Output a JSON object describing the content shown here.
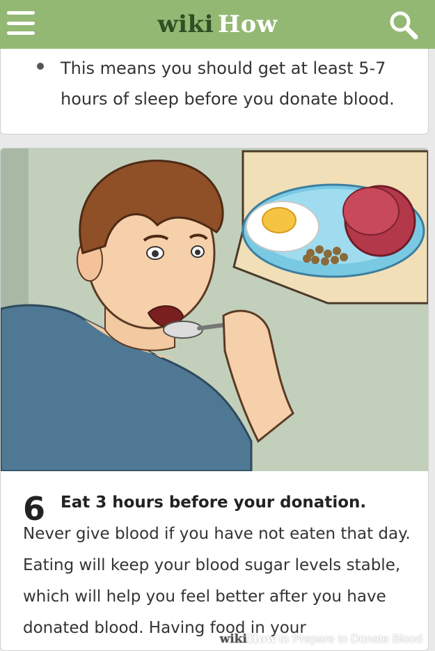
{
  "header": {
    "logo_wiki": "wiki",
    "logo_how": "How",
    "menu_icon": "hamburger-menu-icon",
    "search_icon": "search-icon",
    "bar_color": "#93b874"
  },
  "previous_card": {
    "bullet_text": "This means you should get at least 5-7 hours of sleep before you donate blood."
  },
  "step": {
    "number": "6",
    "title": "Eat 3 hours before your donation.",
    "body": " Never give blood if you have not eaten that day. Eating will keep your blood sugar levels stable, which will help you feel better after you have donated blood. Having food in your",
    "image_caption_wiki": "wiki",
    "image_caption_how": "How",
    "image_caption_rest": "to Prepare to Donate Blood"
  }
}
